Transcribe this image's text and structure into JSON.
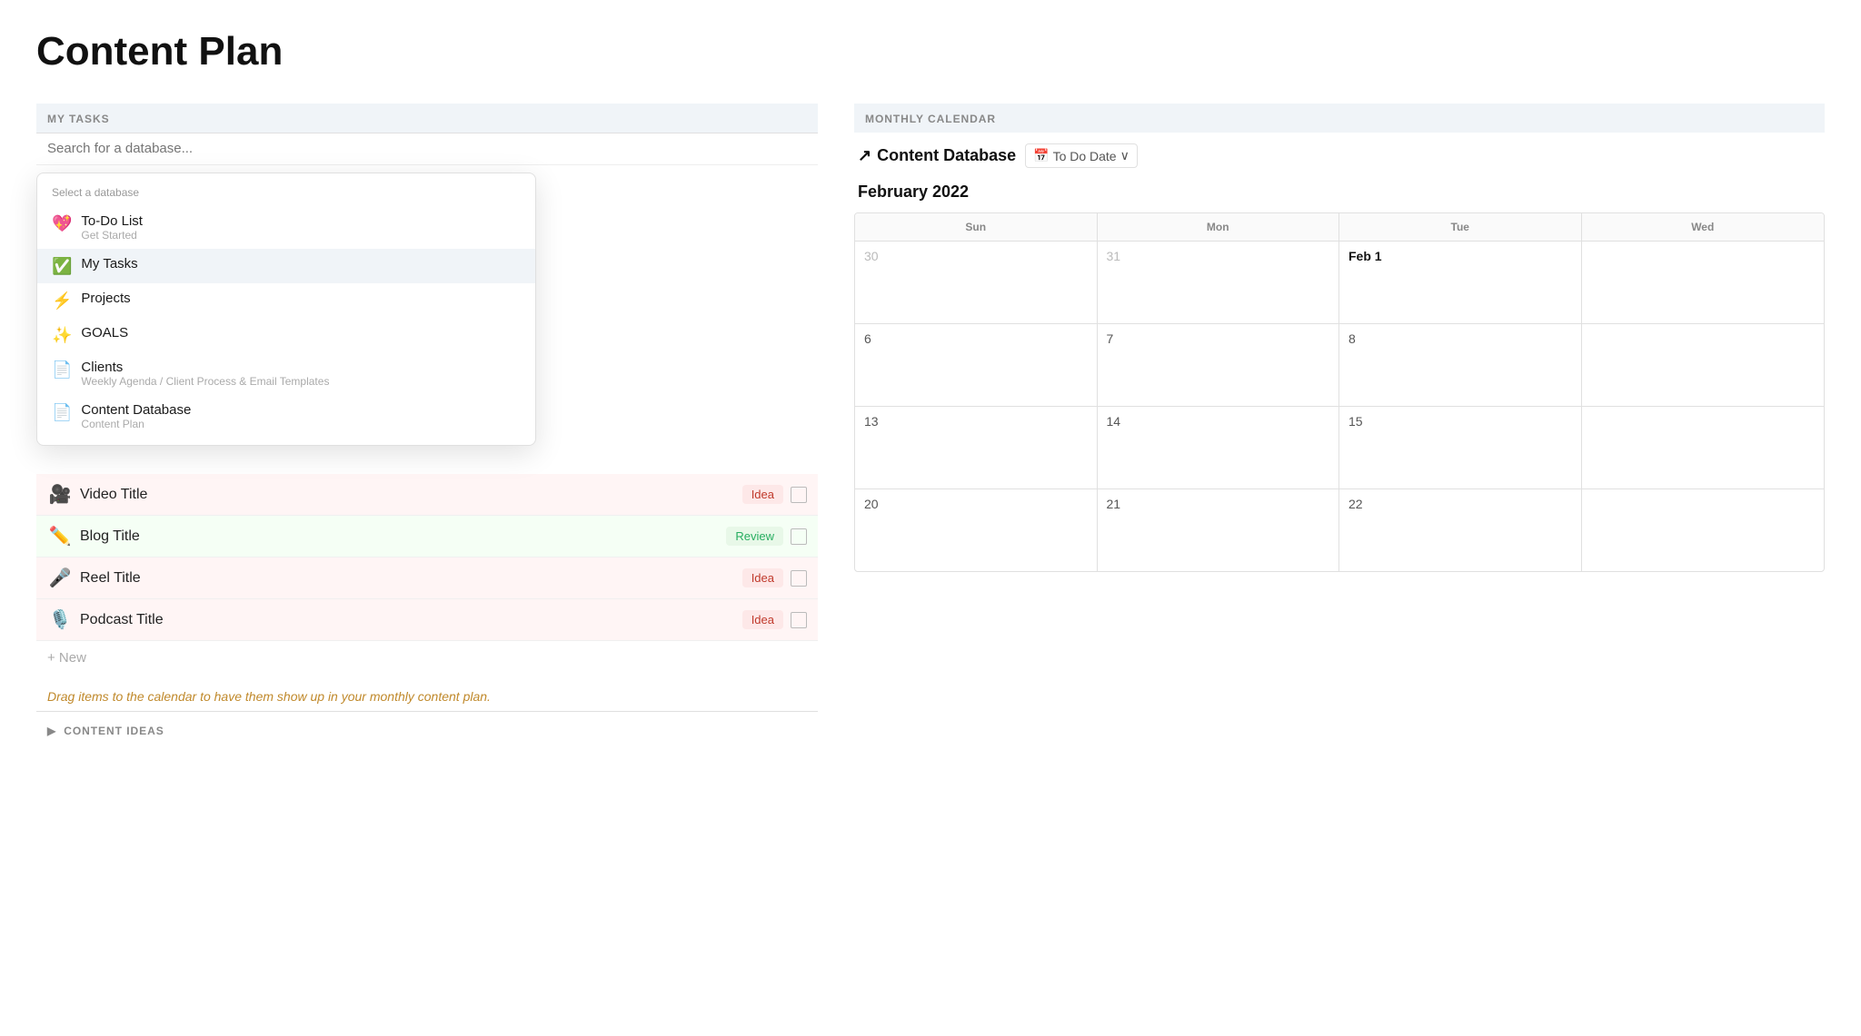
{
  "page": {
    "title": "Content Plan"
  },
  "my_tasks": {
    "header": "MY TASKS",
    "search_placeholder": "Search for a database...",
    "dropdown": {
      "label": "Select a database",
      "items": [
        {
          "id": "todo",
          "icon": "💖",
          "title": "To-Do List",
          "sub": "Get Started",
          "active": false
        },
        {
          "id": "mytasks",
          "icon": "✅",
          "title": "My Tasks",
          "sub": "",
          "active": true
        },
        {
          "id": "projects",
          "icon": "⚡",
          "title": "Projects",
          "sub": "",
          "active": false
        },
        {
          "id": "goals",
          "icon": "✨",
          "title": "GOALS",
          "sub": "",
          "active": false
        },
        {
          "id": "clients",
          "icon": "📄",
          "title": "Clients",
          "sub": "Weekly Agenda / Client Process & Email Templates",
          "active": false
        },
        {
          "id": "contentdb",
          "icon": "📄",
          "title": "Content Database",
          "sub": "Content Plan",
          "active": false
        }
      ]
    },
    "tasks": [
      {
        "icon": "🎥",
        "title": "Video Title",
        "badge": "Idea",
        "badge_type": "idea"
      },
      {
        "icon": "✏️",
        "title": "Blog Title",
        "badge": "Review",
        "badge_type": "review"
      },
      {
        "icon": "🎤",
        "title": "Reel Title",
        "badge": "Idea",
        "badge_type": "idea"
      },
      {
        "icon": "🎙️",
        "title": "Podcast Title",
        "badge": "Idea",
        "badge_type": "idea"
      }
    ],
    "new_label": "+ New",
    "drag_hint": "Drag items to the calendar to have them show up in your monthly content plan."
  },
  "content_ideas": {
    "header": "CONTENT IDEAS"
  },
  "calendar": {
    "header": "MONTHLY CALENDAR",
    "db_link_icon": "↗",
    "db_link_label": "Content Database",
    "filter_icon": "📅",
    "filter_label": "To Do Date",
    "month": "February 2022",
    "day_headers": [
      "Sun",
      "Mon",
      "Tue",
      "Wed"
    ],
    "weeks": [
      [
        {
          "num": "30",
          "is_today": false,
          "is_current_month": false
        },
        {
          "num": "31",
          "is_today": false,
          "is_current_month": false
        },
        {
          "num": "Feb 1",
          "is_today": false,
          "is_current_month": true
        },
        {
          "num": "",
          "is_today": false,
          "is_current_month": false
        }
      ],
      [
        {
          "num": "6",
          "is_today": false,
          "is_current_month": true
        },
        {
          "num": "7",
          "is_today": false,
          "is_current_month": true
        },
        {
          "num": "8",
          "is_today": false,
          "is_current_month": true
        },
        {
          "num": "",
          "is_today": false,
          "is_current_month": false
        }
      ],
      [
        {
          "num": "13",
          "is_today": false,
          "is_current_month": true
        },
        {
          "num": "14",
          "is_today": false,
          "is_current_month": true
        },
        {
          "num": "15",
          "is_today": false,
          "is_current_month": true
        },
        {
          "num": "",
          "is_today": false,
          "is_current_month": false
        }
      ],
      [
        {
          "num": "20",
          "is_today": false,
          "is_current_month": true
        },
        {
          "num": "21",
          "is_today": false,
          "is_current_month": true
        },
        {
          "num": "22",
          "is_today": false,
          "is_current_month": true
        },
        {
          "num": "",
          "is_today": false,
          "is_current_month": false
        }
      ]
    ]
  }
}
